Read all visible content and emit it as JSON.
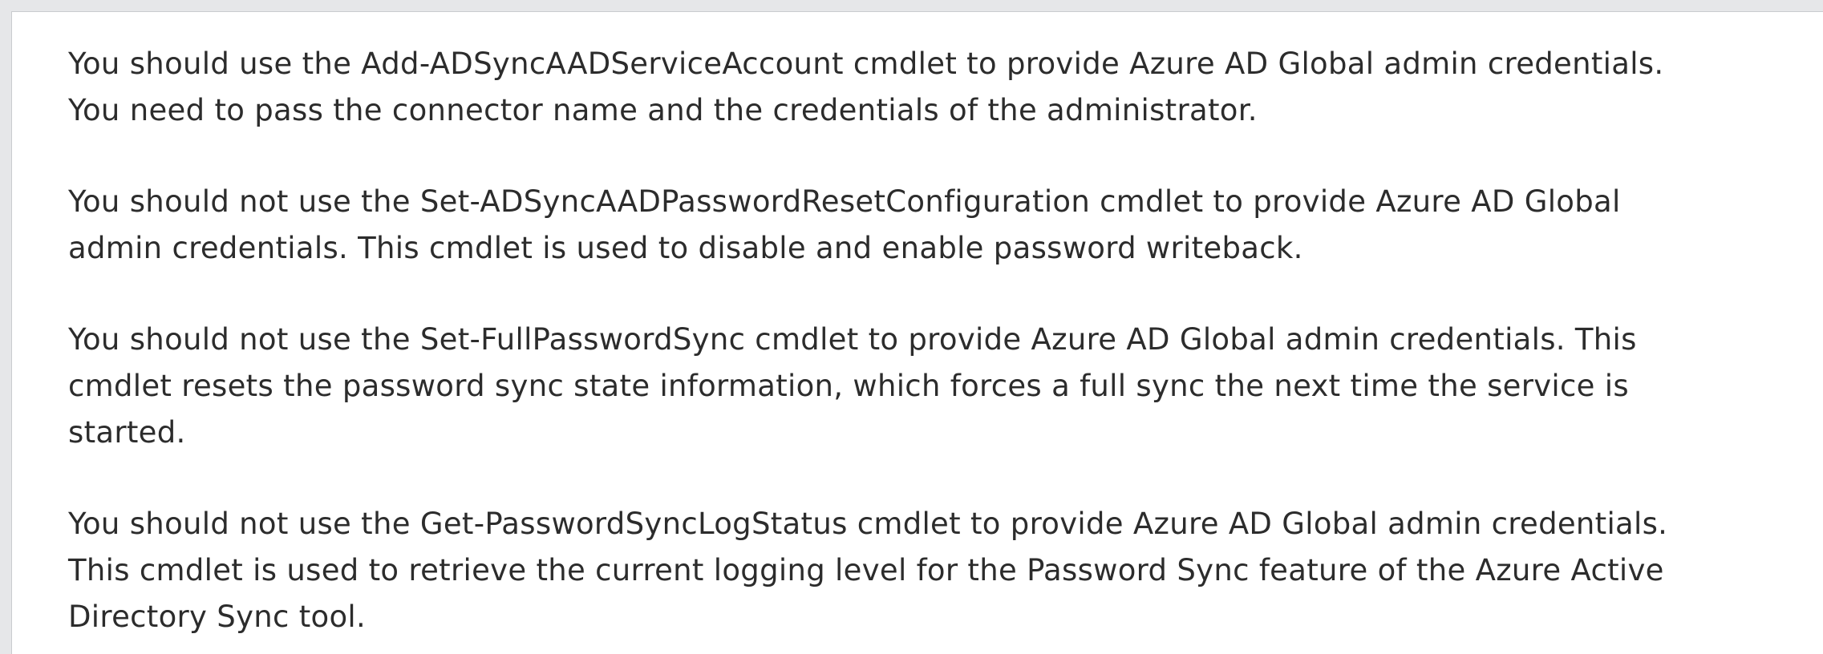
{
  "explanation": {
    "paragraphs": [
      {
        "lines": [
          "You should use the Add-ADSyncAADServiceAccount cmdlet to provide Azure AD Global admin credentials.",
          "You need to pass the connector name and the credentials of the administrator."
        ]
      },
      {
        "lines": [
          "You should not use the Set-ADSyncAADPasswordResetConfiguration cmdlet to provide Azure AD Global",
          "admin credentials. This cmdlet is used to disable and enable password writeback."
        ]
      },
      {
        "lines": [
          "You should not use the Set-FullPasswordSync cmdlet to provide Azure AD Global admin credentials. This",
          "cmdlet resets the password sync state information, which forces a full sync the next time the service is",
          "started."
        ]
      },
      {
        "lines": [
          "You should not use the Get-PasswordSyncLogStatus cmdlet to provide Azure AD Global admin credentials.",
          "This cmdlet is used to retrieve the current logging level for the Password Sync feature of the Azure Active",
          "Directory Sync tool."
        ]
      }
    ]
  },
  "colors": {
    "text": "#2c2c2c",
    "background": "#ffffff",
    "frame_border": "#c9cbcf",
    "page_background": "#e6e7e9"
  }
}
